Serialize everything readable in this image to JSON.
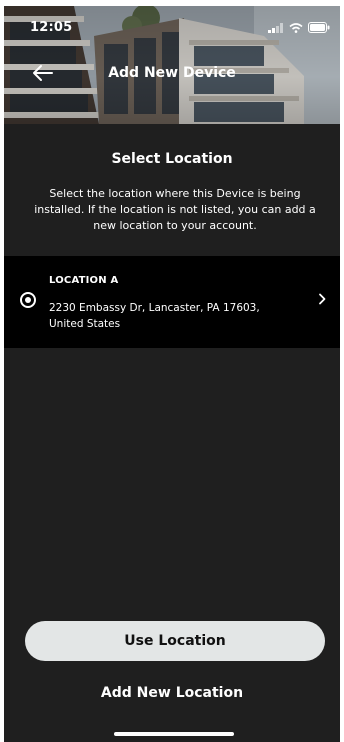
{
  "status_bar": {
    "time": "12:05",
    "icons": [
      "signal-icon",
      "wifi-icon",
      "battery-icon"
    ]
  },
  "header": {
    "title": "Add New Device",
    "back_icon": "back-arrow-icon"
  },
  "section": {
    "title": "Select Location",
    "description": "Select the location where this Device is being installed. If the location is not listed, you can add a new location to your account."
  },
  "locations": [
    {
      "name": "LOCATION A",
      "address": "2230 Embassy Dr, Lancaster, PA 17603, United States",
      "selected": true
    }
  ],
  "actions": {
    "use_location_label": "Use Location",
    "add_location_label": "Add New Location"
  },
  "colors": {
    "background": "#1f1f1f",
    "card": "#000000",
    "button": "#e3e6e6",
    "text": "#ffffff"
  }
}
